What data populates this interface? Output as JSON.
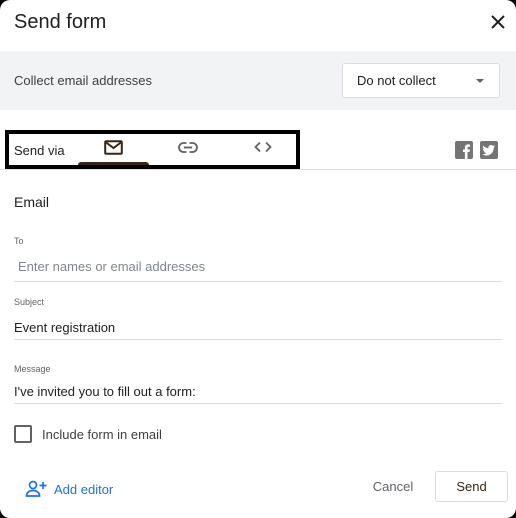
{
  "dialog": {
    "title": "Send form",
    "close_icon": "close-icon"
  },
  "collect": {
    "label": "Collect email addresses",
    "selected": "Do not collect"
  },
  "send_via": {
    "label": "Send via",
    "tabs": [
      {
        "icon": "email-icon",
        "active": true
      },
      {
        "icon": "link-icon",
        "active": false
      },
      {
        "icon": "embed-code-icon",
        "active": false
      }
    ],
    "social": [
      {
        "icon": "facebook-icon"
      },
      {
        "icon": "twitter-icon"
      }
    ]
  },
  "email": {
    "section_title": "Email",
    "to": {
      "label": "To",
      "value": "",
      "placeholder": "Enter names or email addresses"
    },
    "subject": {
      "label": "Subject",
      "value": "Event registration"
    },
    "message": {
      "label": "Message",
      "value": "I've invited you to fill out a form:"
    },
    "include_form": {
      "label": "Include form in email",
      "checked": false
    }
  },
  "footer": {
    "add_editor": "Add editor",
    "cancel": "Cancel",
    "send": "Send"
  },
  "colors": {
    "accent": "#3a2413",
    "link": "#1a73e8",
    "bar_bg": "#f1f3f4"
  }
}
